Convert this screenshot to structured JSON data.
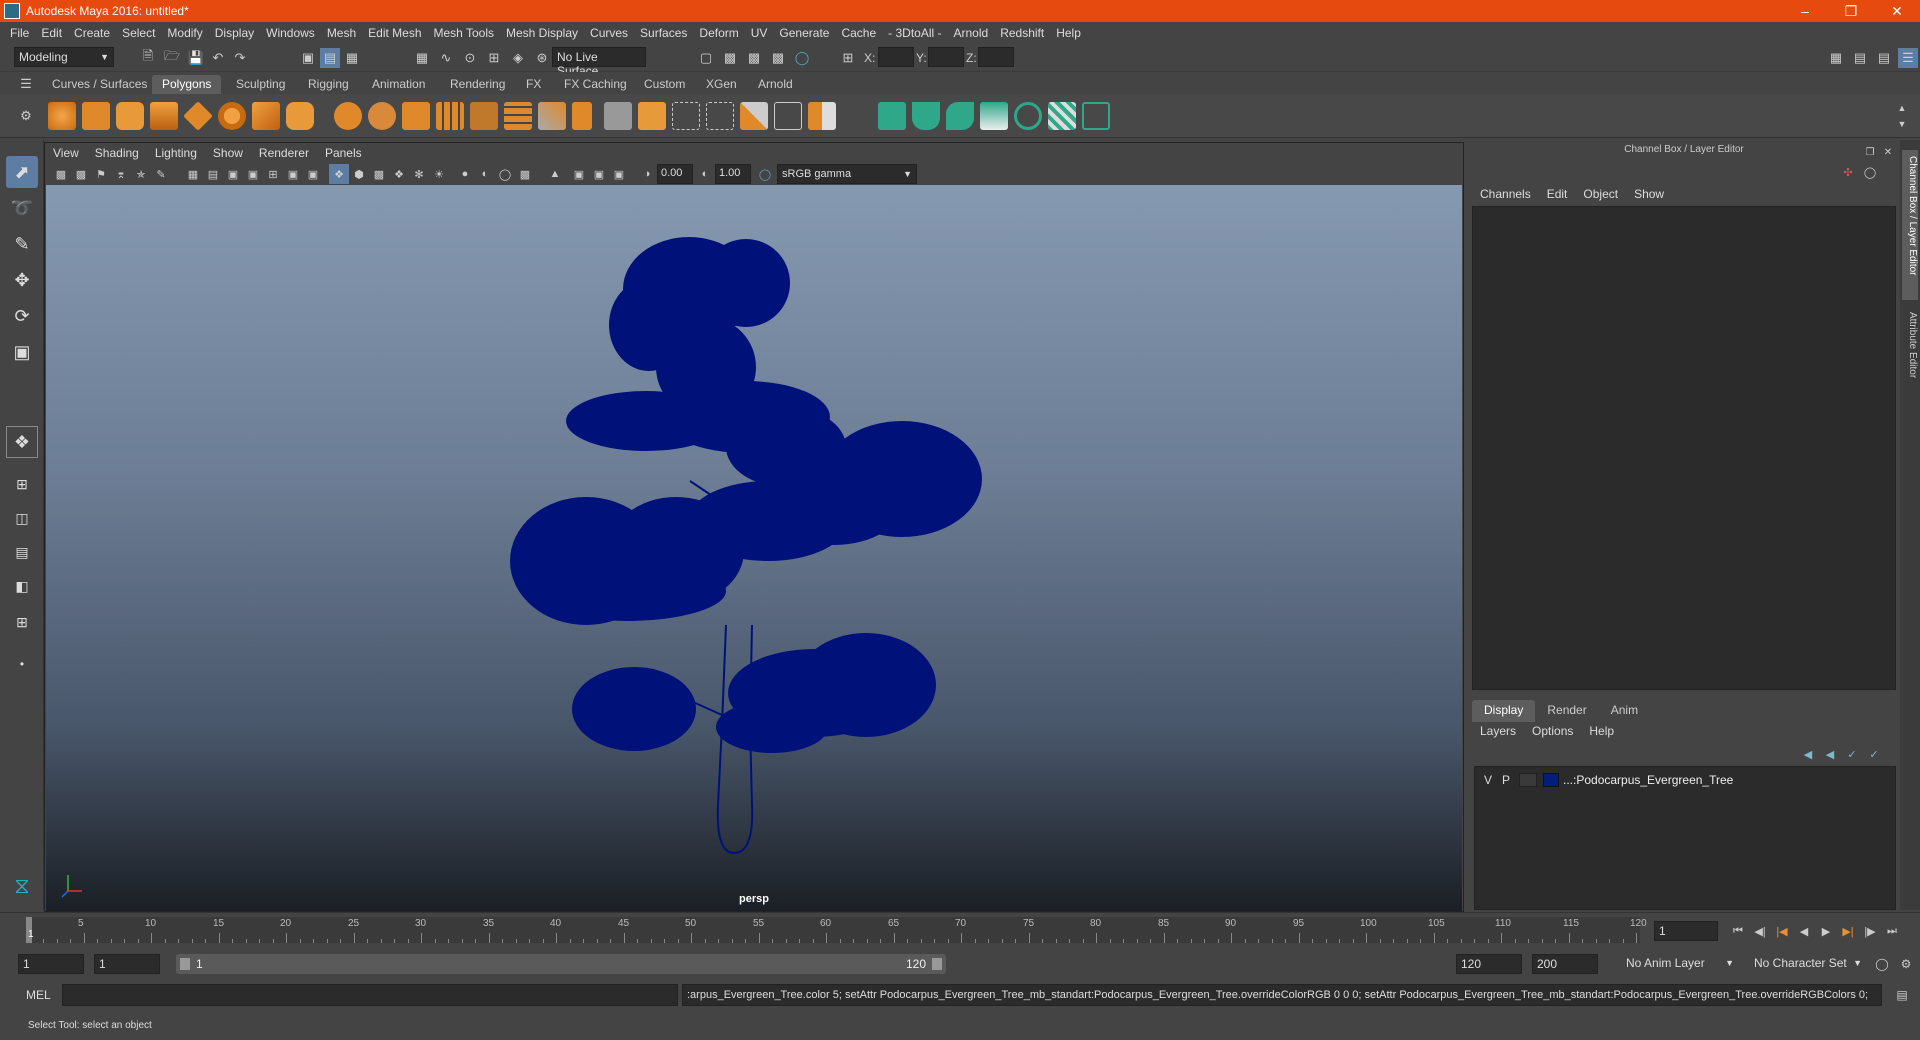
{
  "window": {
    "title": "Autodesk Maya 2016: untitled*"
  },
  "menubar": [
    "File",
    "Edit",
    "Create",
    "Select",
    "Modify",
    "Display",
    "Windows",
    "Mesh",
    "Edit Mesh",
    "Mesh Tools",
    "Mesh Display",
    "Curves",
    "Surfaces",
    "Deform",
    "UV",
    "Generate",
    "Cache",
    "- 3DtoAll -",
    "Arnold",
    "Redshift",
    "Help"
  ],
  "statusline": {
    "mode": "Modeling",
    "live_surface": "No Live Surface",
    "x_label": "X:",
    "y_label": "Y:",
    "z_label": "Z:"
  },
  "shelf_tabs": [
    "Curves / Surfaces",
    "Polygons",
    "Sculpting",
    "Rigging",
    "Animation",
    "Rendering",
    "FX",
    "FX Caching",
    "Custom",
    "XGen",
    "Arnold"
  ],
  "active_shelf_tab": "Polygons",
  "viewport": {
    "menu": [
      "View",
      "Shading",
      "Lighting",
      "Show",
      "Renderer",
      "Panels"
    ],
    "exposure": "0.00",
    "gamma": "1.00",
    "color_space": "sRGB gamma",
    "camera_label": "persp",
    "mesh_color": "#00127a"
  },
  "right_panel": {
    "title": "Channel Box / Layer Editor",
    "cb_menu": [
      "Channels",
      "Edit",
      "Object",
      "Show"
    ],
    "layer_tabs": [
      "Display",
      "Render",
      "Anim"
    ],
    "active_layer_tab": "Display",
    "layer_menu": [
      "Layers",
      "Options",
      "Help"
    ],
    "layer": {
      "v": "V",
      "p": "P",
      "name": "...:Podocarpus_Evergreen_Tree"
    },
    "side_tabs": [
      "Channel Box / Layer Editor",
      "Attribute Editor"
    ]
  },
  "timeline": {
    "ticks": [
      "5",
      "10",
      "15",
      "20",
      "25",
      "30",
      "35",
      "40",
      "45",
      "50",
      "55",
      "60",
      "65",
      "70",
      "75",
      "80",
      "85",
      "90",
      "95",
      "100",
      "105",
      "110",
      "115",
      "120"
    ],
    "current_frame": "1",
    "start_frame_label": "1"
  },
  "range": {
    "start": "1",
    "playback_start": "1",
    "slider_start": "1",
    "slider_end": "120",
    "playback_end": "120",
    "end": "200",
    "anim_layer": "No Anim Layer",
    "character_set": "No Character Set"
  },
  "command_line": {
    "label": "MEL",
    "output": ":arpus_Evergreen_Tree.color 5; setAttr Podocarpus_Evergreen_Tree_mb_standart:Podocarpus_Evergreen_Tree.overrideColorRGB 0 0 0; setAttr Podocarpus_Evergreen_Tree_mb_standart:Podocarpus_Evergreen_Tree.overrideRGBColors 0;"
  },
  "help_line": "Select Tool: select an object"
}
